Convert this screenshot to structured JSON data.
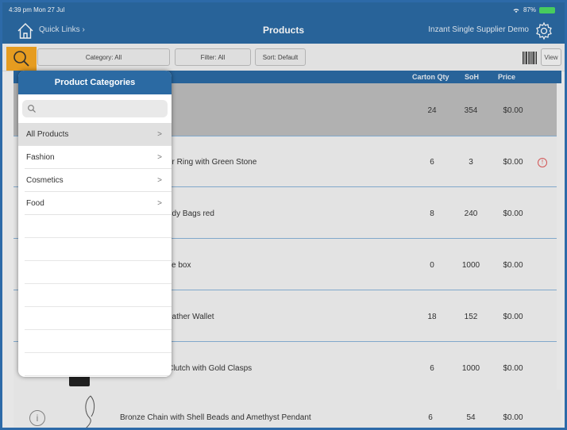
{
  "status_bar": {
    "time_date": "4:39 pm  Mon 27 Jul",
    "battery": "87%"
  },
  "header": {
    "quick_links": "Quick Links ›",
    "title": "Products",
    "supplier": "Inzant Single Supplier Demo"
  },
  "toolbar": {
    "category": "Category: All",
    "filter": "Filter: All",
    "sort": "Sort: Default",
    "view": "View"
  },
  "columns": {
    "carton_qty": "Carton Qty",
    "soh": "SoH",
    "price": "Price"
  },
  "products": [
    {
      "name": "",
      "carton_qty": "24",
      "soh": "354",
      "price": "$0.00"
    },
    {
      "name": "er Ring with Green Stone",
      "carton_qty": "6",
      "soh": "3",
      "price": "$0.00",
      "warning": "!"
    },
    {
      "name": "ndy Bags red",
      "carton_qty": "8",
      "soh": "240",
      "price": "$0.00"
    },
    {
      "name": "fle box",
      "carton_qty": "0",
      "soh": "1000",
      "price": "$0.00"
    },
    {
      "name": "eather Wallet",
      "carton_qty": "18",
      "soh": "152",
      "price": "$0.00"
    },
    {
      "name": "Clutch with Gold Clasps",
      "carton_qty": "6",
      "soh": "1000",
      "price": "$0.00"
    },
    {
      "name": "Bronze Chain with Shell Beads and Amethyst Pendant",
      "carton_qty": "6",
      "soh": "54",
      "price": "$0.00",
      "info": "i"
    }
  ],
  "popover": {
    "title": "Product Categories",
    "categories": [
      {
        "label": "All Products",
        "chevron": ">"
      },
      {
        "label": "Fashion",
        "chevron": ">"
      },
      {
        "label": "Cosmetics",
        "chevron": ">"
      },
      {
        "label": "Food",
        "chevron": ">"
      }
    ]
  },
  "colors": {
    "header_blue": "#2b6aa3",
    "search_highlight": "#f5a623",
    "row_separator": "#8ab3d8",
    "selected_row": "#bdbdbd"
  },
  "icons": [
    "home-icon",
    "gear-icon",
    "search-icon",
    "barcode-icon",
    "wifi-icon",
    "battery-icon",
    "warning-icon",
    "info-icon"
  ]
}
